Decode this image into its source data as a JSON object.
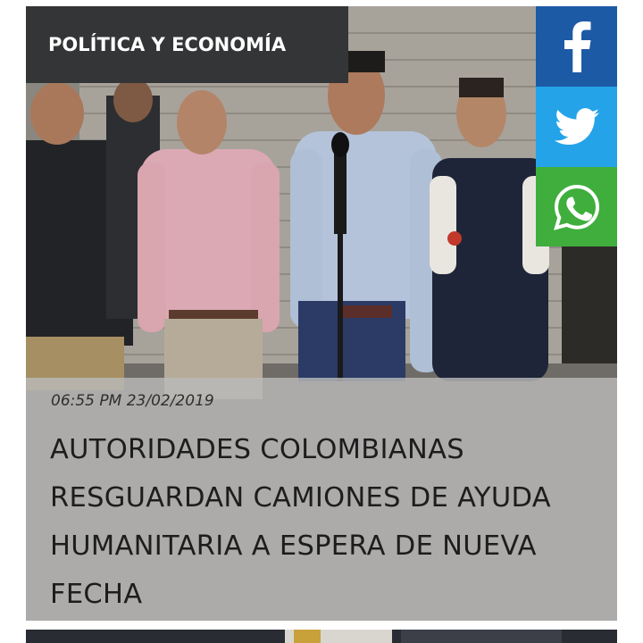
{
  "category": {
    "label": "POLÍTICA Y ECONOMÍA"
  },
  "share": {
    "facebook_icon": "facebook-icon",
    "twitter_icon": "twitter-icon",
    "whatsapp_icon": "whatsapp-icon",
    "colors": {
      "facebook": "#1d5aa6",
      "twitter": "#24a3e8",
      "whatsapp": "#3fae3c"
    }
  },
  "article": {
    "timestamp": "06:55 PM 23/02/2019",
    "headline": "AUTORIDADES COLOMBIANAS RESGUARDAN CAMIONES DE AYUDA HUMANITARIA A ESPERA DE NUEVA FECHA"
  }
}
